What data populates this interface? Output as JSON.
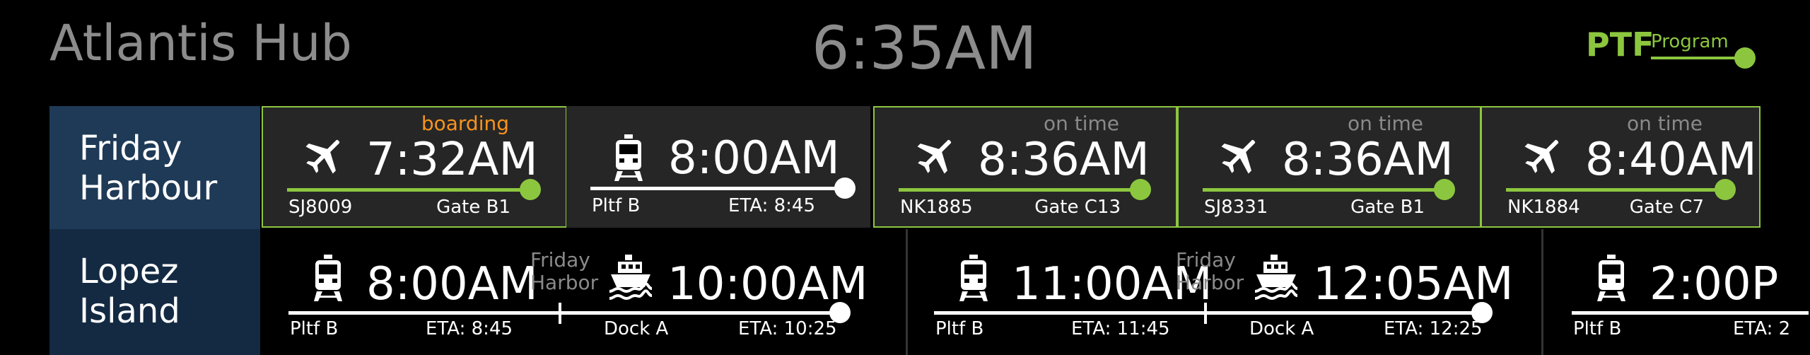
{
  "header": {
    "hub": "Atlantis Hub",
    "clock": "6:35AM",
    "logo_big": "PTF",
    "logo_small": "Program"
  },
  "colors": {
    "accent": "#8cc63f",
    "boarding": "#f7931e"
  },
  "routes": [
    {
      "name_line1": "Friday",
      "name_line2": "Harbour",
      "cards": [
        {
          "status": "boarding",
          "icon": "airplane-icon",
          "time": "7:32AM",
          "left": "SJ8009",
          "right": "Gate B1",
          "highlight": true,
          "progress": 0.95
        },
        {
          "status": "",
          "icon": "train-icon",
          "time": "8:00AM",
          "left": "Pltf B",
          "right": "ETA: 8:45",
          "highlight": false,
          "progress": 1.0
        },
        {
          "status": "on time",
          "icon": "airplane-icon",
          "time": "8:36AM",
          "left": "NK1885",
          "right": "Gate C13",
          "highlight": true,
          "progress": 0.95
        },
        {
          "status": "on time",
          "icon": "airplane-icon",
          "time": "8:36AM",
          "left": "SJ8331",
          "right": "Gate B1",
          "highlight": true,
          "progress": 0.95
        },
        {
          "status": "on time",
          "icon": "airplane-icon",
          "time": "8:40AM",
          "left": "NK1884",
          "right": "Gate C7",
          "highlight": true,
          "progress": 0.95
        }
      ]
    },
    {
      "name_line1": "Lopez",
      "name_line2": "Island",
      "trips": [
        {
          "leg1_icon": "train-icon",
          "leg1_time": "8:00AM",
          "via1": "Friday",
          "via2": "Harbor",
          "leg2_icon": "ferry-icon",
          "leg2_time": "10:00AM",
          "l1": "Pltf B",
          "l2": "ETA: 8:45",
          "l3": "Dock A",
          "l4": "ETA: 10:25"
        },
        {
          "leg1_icon": "train-icon",
          "leg1_time": "11:00AM",
          "via1": "Friday",
          "via2": "Harbor",
          "leg2_icon": "ferry-icon",
          "leg2_time": "12:05AM",
          "l1": "Pltf B",
          "l2": "ETA: 11:45",
          "l3": "Dock A",
          "l4": "ETA: 12:25"
        },
        {
          "leg1_icon": "train-icon",
          "leg1_time": "2:00P",
          "l1": "Pltf B",
          "l2": "ETA: 2"
        }
      ]
    }
  ]
}
